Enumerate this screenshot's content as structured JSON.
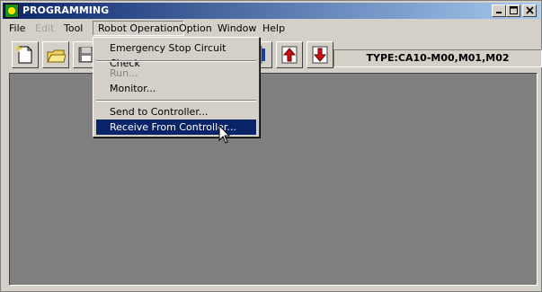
{
  "window": {
    "title": "PROGRAMMING"
  },
  "menubar": {
    "items": [
      {
        "label": "File",
        "enabled": true
      },
      {
        "label": "Edit",
        "enabled": false
      },
      {
        "label": "Tool",
        "enabled": true
      },
      {
        "label": "Robot Operation",
        "enabled": true,
        "open": true
      },
      {
        "label": "Option",
        "enabled": true
      },
      {
        "label": "Window",
        "enabled": true
      },
      {
        "label": "Help",
        "enabled": true
      }
    ]
  },
  "dropdown": {
    "items": [
      {
        "label": "Emergency Stop Circuit Check",
        "enabled": true
      },
      {
        "label": "Run...",
        "enabled": false
      },
      {
        "label": "Monitor...",
        "enabled": true
      },
      {
        "label": "Send to Controller...",
        "enabled": true
      },
      {
        "label": "Receive From Controller...",
        "enabled": true,
        "selected": true
      }
    ]
  },
  "toolbar": {
    "type_label": "TYPE:CA10-M00,M01,M02",
    "icons": [
      "new-document-icon",
      "open-folder-icon",
      "save-icon",
      "edit-icon",
      "upload-icon",
      "download-icon"
    ]
  },
  "colors": {
    "titlebar_start": "#0a246a",
    "titlebar_end": "#a6caf0",
    "workspace": "#808080",
    "selection": "#0a246a",
    "face": "#d4d0c8"
  }
}
